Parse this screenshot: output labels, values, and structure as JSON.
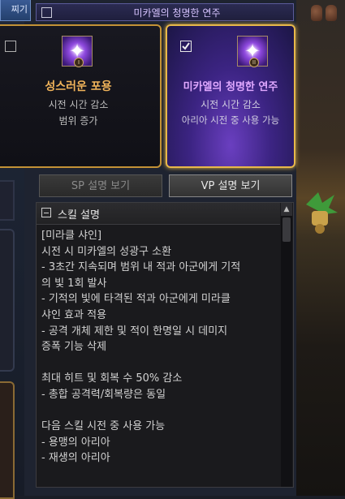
{
  "top_left_tab": {
    "label": "찌기"
  },
  "top_bar": {
    "title": "미카엘의 청명한 연주"
  },
  "cards": {
    "holy": {
      "title": "성스러운 포용",
      "line1": "시전 시간 감소",
      "line2": "범위 증가",
      "checked": false,
      "badge": "I",
      "title_color": "#f0b35a"
    },
    "michael": {
      "title": "미카엘의 청명한 연주",
      "line1": "시전 시간 감소",
      "line2": "아리아 시전 중 사용 가능",
      "checked": true,
      "badge": "II",
      "title_color": "#e0a8ff"
    }
  },
  "tabs": {
    "sp": "SP 설명 보기",
    "vp": "VP 설명 보기"
  },
  "skill_desc": {
    "header": "스킬 설명",
    "lines": [
      "[미라클 샤인]",
      "시전 시 미카엘의 성광구 소환",
      "- 3초간 지속되며 범위 내 적과 아군에게 기적",
      "의 빛 1회 발사",
      "- 기적의 빛에 타격된 적과 아군에게 미라클",
      "샤인 효과 적용",
      "- 공격 개체 제한 및 적이 한명일 시 데미지",
      "증폭 기능 삭제",
      "",
      "최대 히트 및 회복 수 50% 감소",
      "- 총합 공격력/회복량은 동일",
      "",
      "다음 스킬 시전 중 사용 가능",
      "- 용맹의 아리아",
      "- 재생의 아리아"
    ]
  },
  "icons": {
    "card_checkbox": "checkbox-icon",
    "skill": "magic-staff-icon",
    "collapse": "collapse-icon",
    "scroll_up": "scroll-up-icon"
  },
  "colors": {
    "gold_border": "#e8b84a",
    "selected_bg": "#3c2483"
  }
}
